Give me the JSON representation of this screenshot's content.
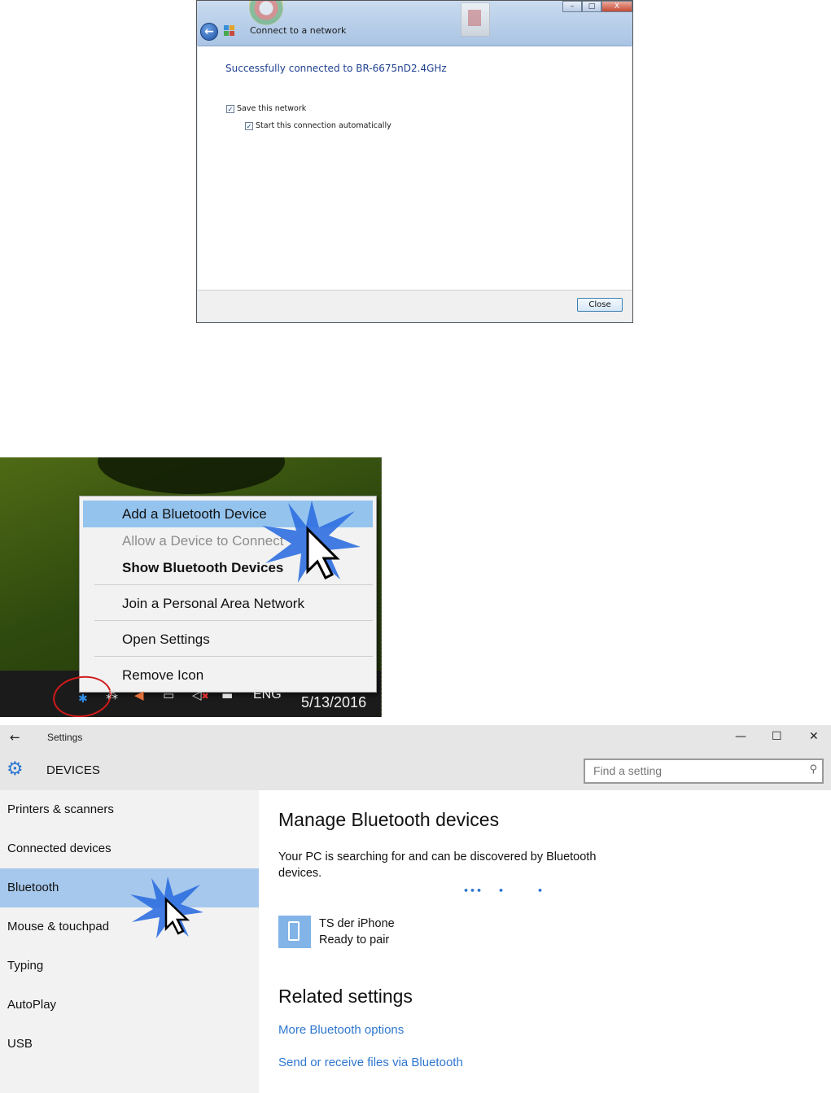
{
  "connect_dialog": {
    "window_title": "Connect to a network",
    "window_buttons": [
      "–",
      "□",
      "X"
    ],
    "back_arrow": "←",
    "message": "Successfully connected to BR-6675nD2.4GHz",
    "checkboxes": [
      {
        "label": "Save this network",
        "checked": true
      },
      {
        "label": "Start this connection automatically",
        "checked": true
      }
    ],
    "close_button": "Close"
  },
  "bluetooth_menu": {
    "items": [
      {
        "label": "Add a Bluetooth Device",
        "state": "highlighted"
      },
      {
        "label": "Allow a Device to Connect",
        "state": "disabled"
      },
      {
        "label": "Show Bluetooth Devices",
        "state": "bold"
      },
      {
        "label": "Join a Personal Area Network",
        "state": "normal"
      },
      {
        "label": "Open Settings",
        "state": "normal"
      },
      {
        "label": "Remove Icon",
        "state": "normal"
      }
    ],
    "taskbar": {
      "language": "ENG",
      "date": "5/13/2016"
    },
    "icons": [
      "bluetooth-icon",
      "network-icon",
      "volume-icon",
      "display-icon",
      "muted-speaker-icon",
      "action-center-icon"
    ]
  },
  "settings": {
    "back_arrow": "←",
    "app_title": "Settings",
    "window_controls": [
      "—",
      "☐",
      "✕"
    ],
    "section_title": "DEVICES",
    "search": {
      "placeholder": "Find a setting",
      "icon": "search-icon"
    },
    "sidebar": {
      "items": [
        {
          "label": "Printers & scanners",
          "selected": false
        },
        {
          "label": "Connected devices",
          "selected": false
        },
        {
          "label": "Bluetooth",
          "selected": true
        },
        {
          "label": "Mouse & touchpad",
          "selected": false
        },
        {
          "label": "Typing",
          "selected": false
        },
        {
          "label": "AutoPlay",
          "selected": false
        },
        {
          "label": "USB",
          "selected": false
        }
      ]
    },
    "main": {
      "heading": "Manage Bluetooth devices",
      "description": "Your PC is searching for and can be discovered by Bluetooth devices.",
      "progress_dots": [
        "•••",
        "•",
        "•"
      ],
      "device": {
        "name": "TS der iPhone",
        "status": "Ready to pair",
        "icon": "phone-icon"
      },
      "related_heading": "Related settings",
      "links": [
        "More Bluetooth options",
        "Send or receive files via Bluetooth"
      ]
    },
    "colors": {
      "accent": "#2f77d0",
      "selected_nav": "#a6c8ec",
      "sidebar_bg": "#f2f2f2",
      "titlebar_bg": "#e6e6e6"
    }
  }
}
